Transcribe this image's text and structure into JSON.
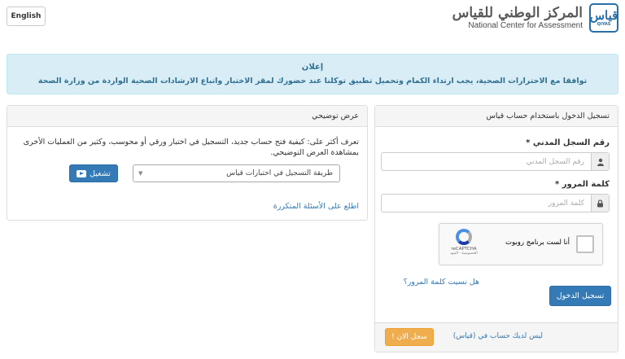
{
  "header": {
    "language_button": "English",
    "logo_ar": "المركز الوطني للقياس",
    "logo_en": "National Center for Assessment",
    "logo_mark": "قياس",
    "logo_mark_sub": "QIYAS"
  },
  "announcement": {
    "title": "إعلان",
    "body": "توافقا مع الاحترازات الصحية، يجب ارتداء الكمام وتحميل تطبيق توكلنا عند حضورك لمقر الاختبار واتباع الارشادات الصحية الواردة من وزارة الصحة"
  },
  "login": {
    "heading": "تسجيل الدخول باستخدام حساب قياس",
    "civil_id_label": "رقم السجل المدني *",
    "civil_id_placeholder": "رقم السجل المدني",
    "password_label": "كلمة المرور *",
    "password_placeholder": "كلمة المرور",
    "recaptcha_label": "أنا لست برنامج روبوت",
    "recaptcha_brand": "reCAPTCHA",
    "recaptcha_terms": "الخصوصية - البنود",
    "forgot_password": "هل نسيت كلمة المرور؟",
    "submit": "تسجيل الدخول",
    "no_account": "ليس لديك حساب في (قياس)",
    "register_now": "سجل الان !"
  },
  "demo": {
    "heading": "عرض توضيحي",
    "description": "تعرف أكثر على: كيفية فتح حساب جديد، التسجيل في اختبار ورقي أو محوسب، وكثير من العمليات الأخرى بمشاهدة العرض التوضيحي.",
    "select_value": "طريقة التسجيل في اختبارات قياس",
    "play_button": "تشغيل",
    "faq_link": "اطلع على الأسئلة المتكررة"
  }
}
